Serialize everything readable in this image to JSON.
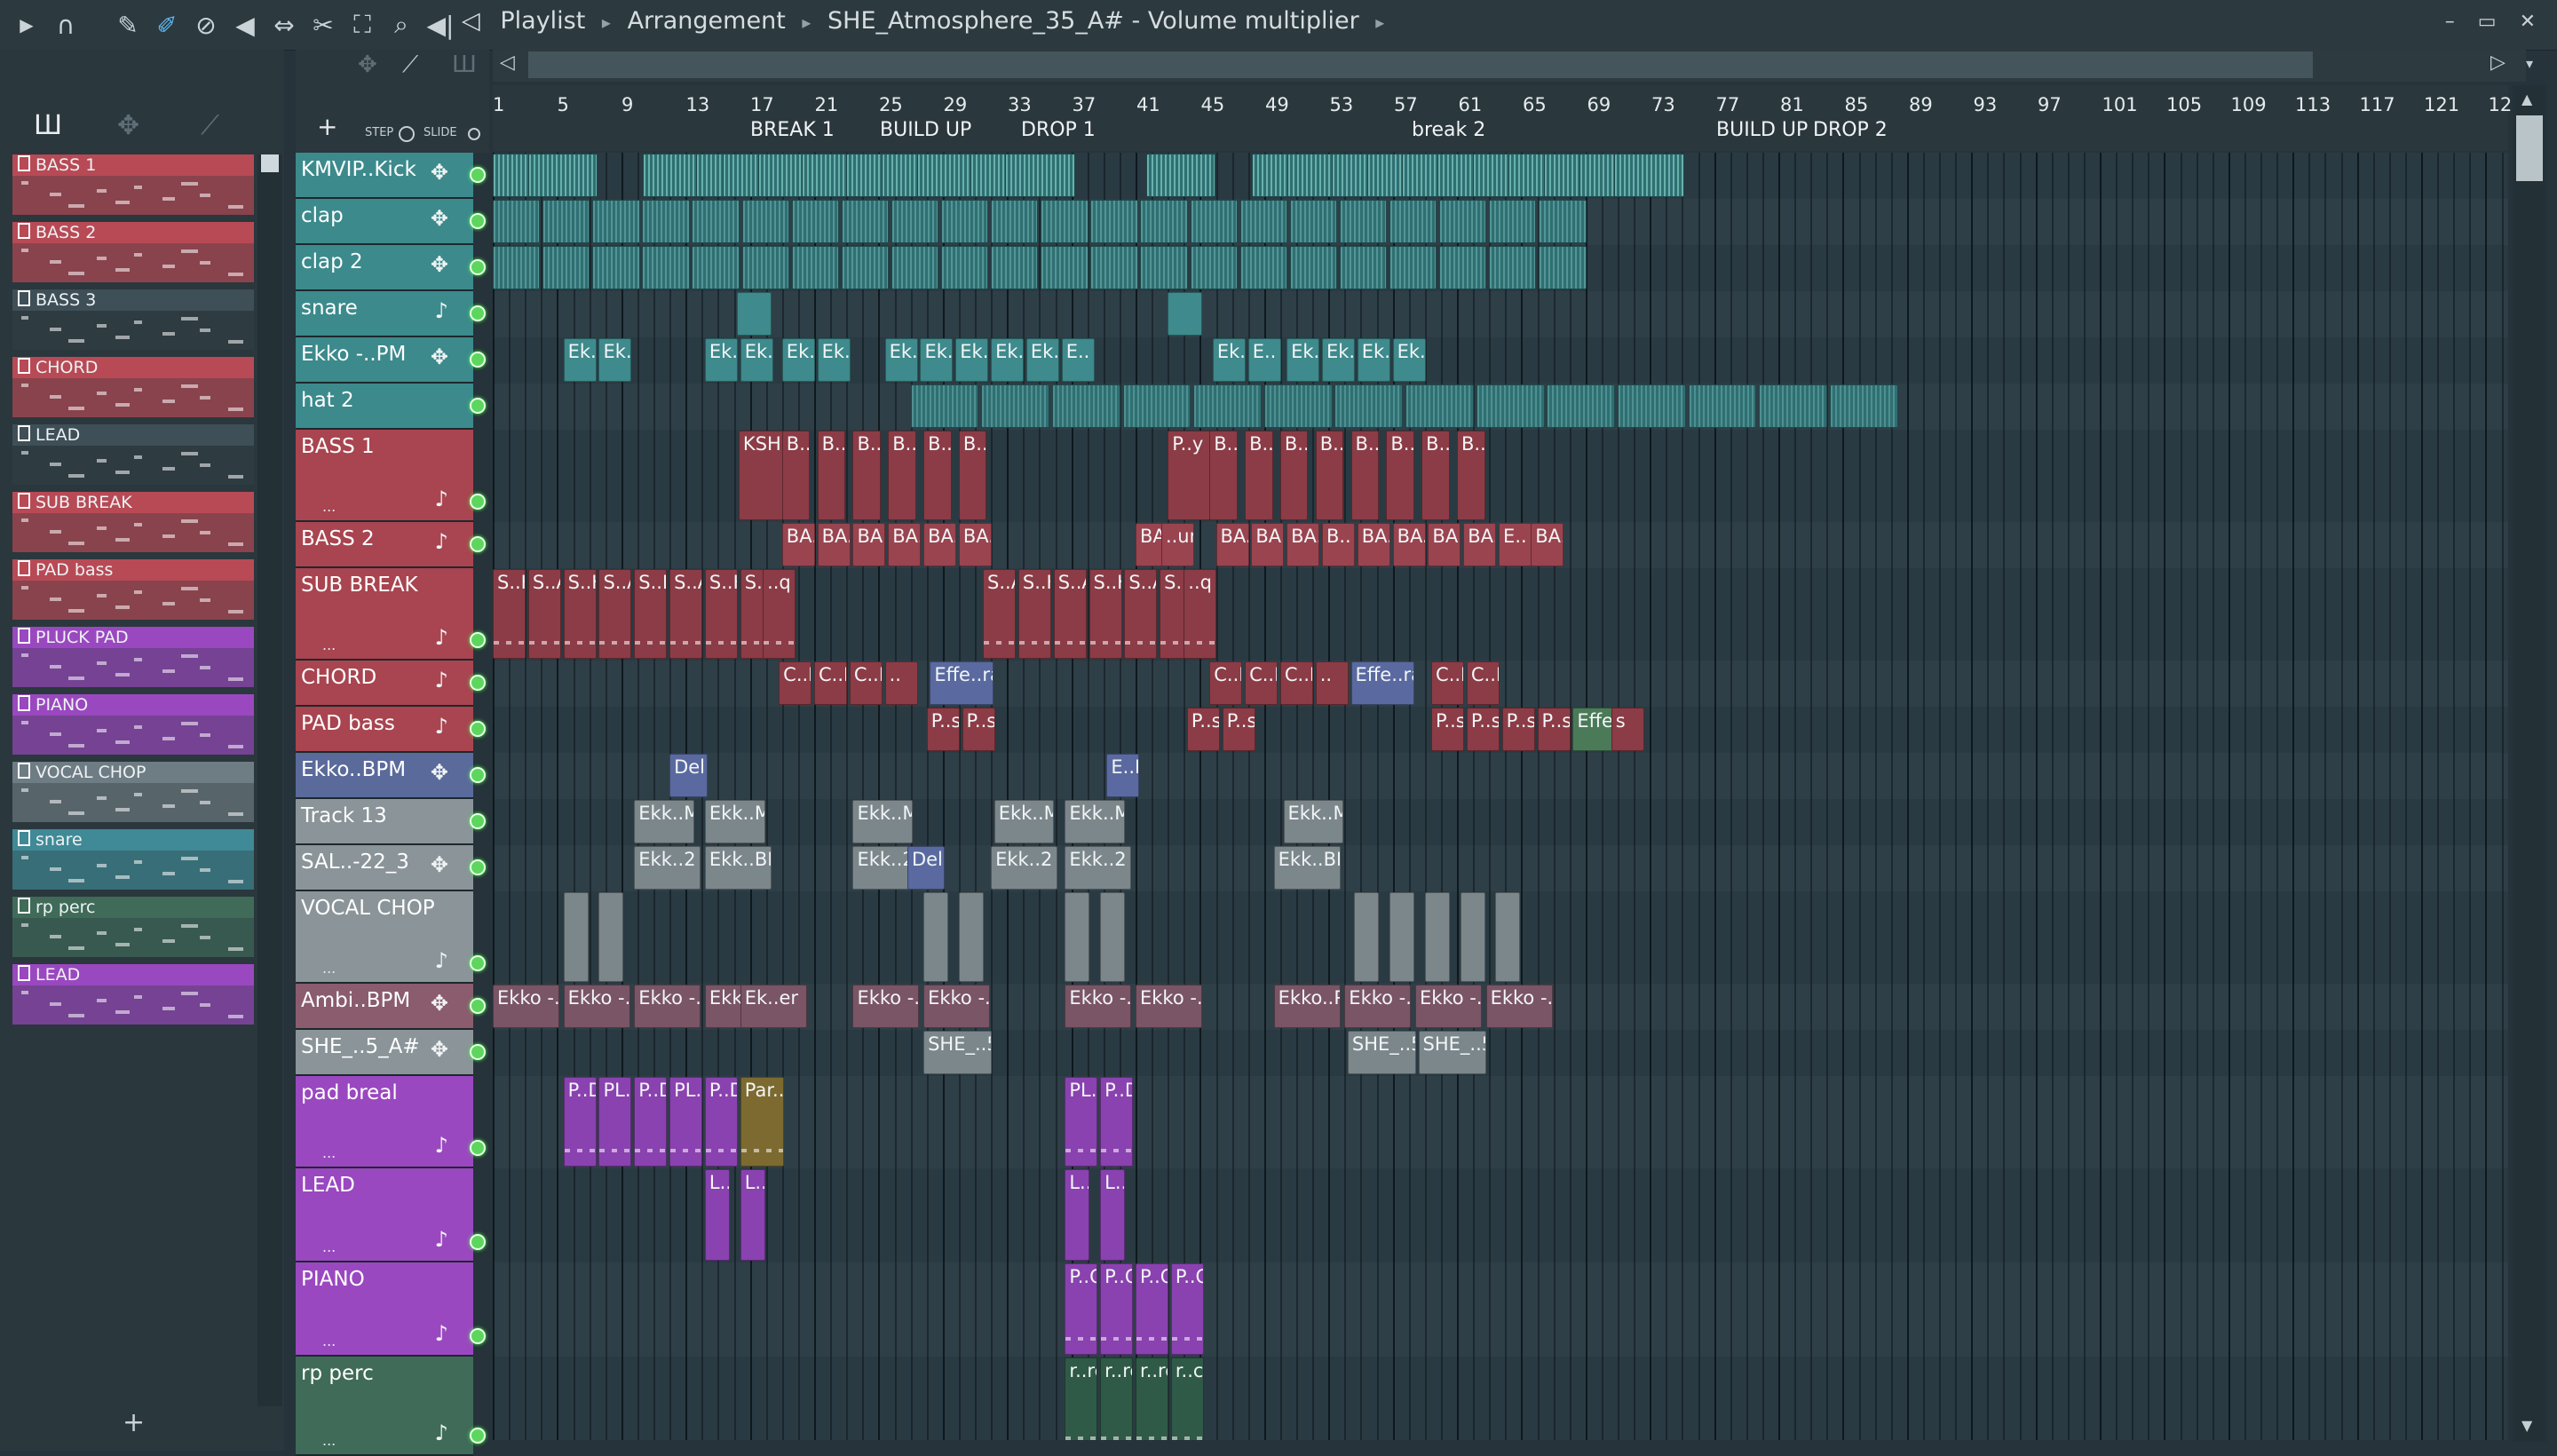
{
  "window": {
    "breadcrumb": [
      "Playlist",
      "Arrangement",
      "SHE_Atmosphere_35_A#",
      "Volume multiplier"
    ]
  },
  "toolbar": {
    "icons": [
      "play-arrow-icon",
      "magnet-icon",
      "pencil-icon",
      "paint-brush-icon",
      "delete-icon",
      "mute-icon",
      "slip-icon",
      "slice-icon",
      "select-icon",
      "zoom-icon",
      "playback-icon"
    ]
  },
  "controls": {
    "step_label": "STEP",
    "slide_label": "SLIDE",
    "add_label": "+"
  },
  "patterns": [
    {
      "name": "BASS 1",
      "color": "#b84a55"
    },
    {
      "name": "BASS 2",
      "color": "#b84a55"
    },
    {
      "name": "BASS 3",
      "color": "#3f4f57"
    },
    {
      "name": "CHORD",
      "color": "#b84a55"
    },
    {
      "name": "LEAD",
      "color": "#3f4f57"
    },
    {
      "name": "SUB BREAK",
      "color": "#b84a55"
    },
    {
      "name": "PAD bass",
      "color": "#b84a55"
    },
    {
      "name": "PLUCK PAD",
      "color": "#9a48c0"
    },
    {
      "name": "PIANO",
      "color": "#9a48c0"
    },
    {
      "name": "VOCAL CHOP",
      "color": "#6e7c83"
    },
    {
      "name": "snare",
      "color": "#3f8a96"
    },
    {
      "name": "rp perc",
      "color": "#3f6b58"
    },
    {
      "name": "LEAD",
      "color": "#9a48c0"
    }
  ],
  "ruler": {
    "bars": [
      "1",
      "5",
      "9",
      "13",
      "17",
      "21",
      "25",
      "29",
      "33",
      "37",
      "41",
      "45",
      "49",
      "53",
      "57",
      "61",
      "65",
      "69",
      "73",
      "77",
      "81",
      "85",
      "89",
      "93",
      "97",
      "101",
      "105",
      "109",
      "113",
      "117",
      "121",
      "12"
    ],
    "markers": [
      "BREAK 1",
      "BUILD UP",
      "DROP 1",
      "break 2",
      "BUILD UP",
      "DROP 2"
    ]
  },
  "tracks": [
    {
      "name": "KMVIP..Kick",
      "icon": "audio-icon",
      "color": "#3c8a8c"
    },
    {
      "name": "clap",
      "icon": "audio-icon",
      "color": "#3c8a8c"
    },
    {
      "name": "clap 2",
      "icon": "audio-icon",
      "color": "#3c8a8c"
    },
    {
      "name": "snare",
      "icon": "note-icon",
      "color": "#3c8a8c"
    },
    {
      "name": "Ekko -..PM",
      "icon": "audio-icon",
      "color": "#3c8a8c"
    },
    {
      "name": "hat 2",
      "icon": "",
      "color": "#3c8a8c"
    },
    {
      "name": "BASS 1",
      "icon": "note-icon",
      "color": "#a84550"
    },
    {
      "name": "BASS 2",
      "icon": "note-icon",
      "color": "#a84550"
    },
    {
      "name": "SUB BREAK",
      "icon": "note-icon",
      "color": "#a84550"
    },
    {
      "name": "CHORD",
      "icon": "note-icon",
      "color": "#a84550"
    },
    {
      "name": "PAD bass",
      "icon": "note-icon",
      "color": "#a84550"
    },
    {
      "name": "Ekko..BPM",
      "icon": "audio-icon",
      "color": "#5a6a9a"
    },
    {
      "name": "Track 13",
      "icon": "",
      "color": "#8a9499"
    },
    {
      "name": "SAL..-22_3",
      "icon": "audio-icon",
      "color": "#8a9499"
    },
    {
      "name": "VOCAL CHOP",
      "icon": "note-icon",
      "color": "#8a9499"
    },
    {
      "name": "Ambi..BPM",
      "icon": "audio-icon",
      "color": "#8a5c6e"
    },
    {
      "name": "SHE_..5_A#",
      "icon": "audio-icon",
      "color": "#8a9499"
    },
    {
      "name": "pad breal",
      "icon": "note-icon",
      "color": "#9a48c0"
    },
    {
      "name": "LEAD",
      "icon": "note-icon",
      "color": "#9a48c0"
    },
    {
      "name": "PIANO",
      "icon": "note-icon",
      "color": "#9a48c0"
    },
    {
      "name": "rp perc",
      "icon": "note-icon",
      "color": "#3f6b58"
    }
  ],
  "clip_labels": {
    "ekko": [
      "Ek..",
      "Ek..",
      "Ek..",
      "Ek..r",
      "Ek..",
      "Ek..",
      "Ek..",
      "Ek..",
      "Ek..",
      "Ek..",
      "Ek..",
      "E..",
      "Ek..",
      "E..",
      "Ek..",
      "Ek..",
      "Ek..",
      "Ek.."
    ],
    "bass1": [
      "KSH..h",
      "B..",
      "B..",
      "B..",
      "B..",
      "B..",
      "B..",
      "P..y #2",
      "B..",
      "B..",
      "B..",
      "B..",
      "B..",
      "B..",
      "B..",
      "B.."
    ],
    "bass2": [
      "BA..",
      "BA..",
      "BA..",
      "BA..",
      "BA..",
      "BA..",
      "BA..",
      "..umel",
      "BA..",
      "BA..",
      "BA..",
      "B..",
      "BA..",
      "BA..",
      "BA..",
      "BA..",
      "E..",
      "BA.."
    ],
    "subbreak": [
      "S..K",
      "S..AK",
      "S..K",
      "S..AK",
      "S..K",
      "S..AK",
      "S..K",
      "S..",
      "..q",
      "S..AK",
      "S..K",
      "S..AK",
      "S..K",
      "S..AK",
      "S..",
      "..q"
    ],
    "chord": [
      "C..D",
      "C..D",
      "C..D",
      "..",
      "Effe..ram X",
      "C..D",
      "C..D",
      "C..D",
      "..",
      "Effe..ram X",
      "C..D",
      "C..D"
    ],
    "padbass": [
      "P..s",
      "P..s",
      "P..s",
      "P..s",
      "P..s",
      "P..s",
      "P..s",
      "P..s",
      "Effe..m X",
      "s"
    ],
    "ekkobpm": [
      "Del..l",
      "E..M"
    ],
    "track13": [
      "Ekk..M #2",
      "Ekk..M #2",
      "Ekk..M #2",
      "Ekk..M #2",
      "Ekk..M #2",
      "Ekk..M #2"
    ],
    "sal": [
      "Ekk..2 BPM",
      "Ekk..BPM",
      "Ekk..2",
      "Del..l",
      "Ekk..2",
      "Ekk..2 BPM",
      "Ekk..BPM"
    ],
    "ambi": [
      "Ekko -..PM",
      "Ekko -..PM",
      "Ekko -..PM",
      "Ekk",
      "Ek..er",
      "Ekko -..PM",
      "Ekko -..PM",
      "Ekko -..PM",
      "Ekko -..PM",
      "Ekko..PM",
      "Ekko -..PM",
      "Ekko -..PM",
      "Ekko -..PM"
    ],
    "she": [
      "SHE_..5",
      "SHE_..5_A#",
      "SHE_..5_A#"
    ],
    "padbreal": [
      "P..D",
      "PL..D",
      "P..D",
      "PL..D",
      "P..D",
      "Par..eq",
      "PL..D",
      "P..D"
    ],
    "lead": [
      "L..",
      "L..",
      "L..",
      "L.."
    ],
    "piano": [
      "P..O",
      "P..O",
      "P..O",
      "P..O"
    ],
    "rpperc": [
      "r..rc",
      "r..rc",
      "r..rc",
      "r..c"
    ]
  }
}
